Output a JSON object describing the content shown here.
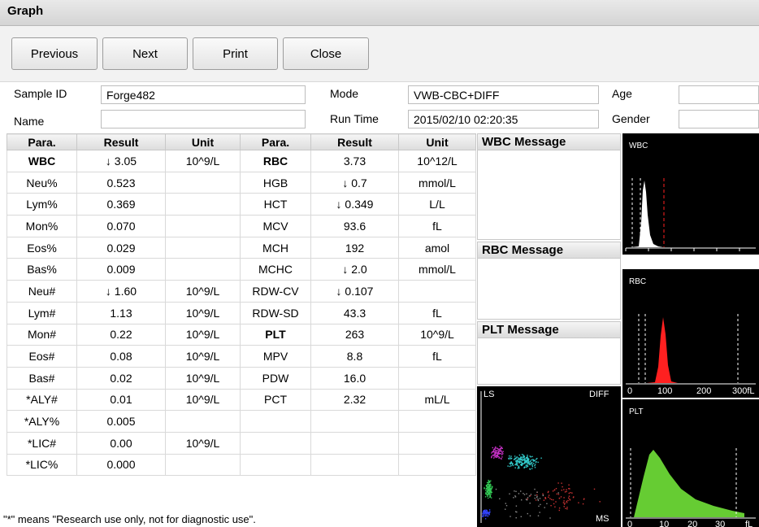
{
  "window": {
    "title": "Graph"
  },
  "toolbar": {
    "previous": "Previous",
    "next": "Next",
    "print": "Print",
    "close": "Close"
  },
  "info": {
    "sample_id_label": "Sample ID",
    "sample_id": "Forge482",
    "mode_label": "Mode",
    "mode": "VWB-CBC+DIFF",
    "age_label": "Age",
    "age": "",
    "name_label": "Name",
    "name": "",
    "run_time_label": "Run Time",
    "run_time": "2015/02/10 02:20:35",
    "gender_label": "Gender",
    "gender": ""
  },
  "table": {
    "headers": [
      "Para.",
      "Result",
      "Unit",
      "Para.",
      "Result",
      "Unit"
    ],
    "rows": [
      {
        "p1": "WBC",
        "r1": "↓ 3.05",
        "u1": "10^9/L",
        "p2": "RBC",
        "r2": "3.73",
        "u2": "10^12/L"
      },
      {
        "p1": "Neu%",
        "r1": "0.523",
        "u1": "",
        "p2": "HGB",
        "r2": "↓ 0.7",
        "u2": "mmol/L"
      },
      {
        "p1": "Lym%",
        "r1": "0.369",
        "u1": "",
        "p2": "HCT",
        "r2": "↓ 0.349",
        "u2": "L/L"
      },
      {
        "p1": "Mon%",
        "r1": "0.070",
        "u1": "",
        "p2": "MCV",
        "r2": "93.6",
        "u2": "fL"
      },
      {
        "p1": "Eos%",
        "r1": "0.029",
        "u1": "",
        "p2": "MCH",
        "r2": "192",
        "u2": "amol"
      },
      {
        "p1": "Bas%",
        "r1": "0.009",
        "u1": "",
        "p2": "MCHC",
        "r2": "↓ 2.0",
        "u2": "mmol/L"
      },
      {
        "p1": "Neu#",
        "r1": "↓ 1.60",
        "u1": "10^9/L",
        "p2": "RDW-CV",
        "r2": "↓ 0.107",
        "u2": ""
      },
      {
        "p1": "Lym#",
        "r1": "1.13",
        "u1": "10^9/L",
        "p2": "RDW-SD",
        "r2": "43.3",
        "u2": "fL"
      },
      {
        "p1": "Mon#",
        "r1": "0.22",
        "u1": "10^9/L",
        "p2": "PLT",
        "r2": "263",
        "u2": "10^9/L"
      },
      {
        "p1": "Eos#",
        "r1": "0.08",
        "u1": "10^9/L",
        "p2": "MPV",
        "r2": "8.8",
        "u2": "fL"
      },
      {
        "p1": "Bas#",
        "r1": "0.02",
        "u1": "10^9/L",
        "p2": "PDW",
        "r2": "16.0",
        "u2": ""
      },
      {
        "p1": "*ALY#",
        "r1": "0.01",
        "u1": "10^9/L",
        "p2": "PCT",
        "r2": "2.32",
        "u2": "mL/L"
      },
      {
        "p1": "*ALY%",
        "r1": "0.005",
        "u1": "",
        "p2": "",
        "r2": "",
        "u2": ""
      },
      {
        "p1": "*LIC#",
        "r1": "0.00",
        "u1": "10^9/L",
        "p2": "",
        "r2": "",
        "u2": ""
      },
      {
        "p1": "*LIC%",
        "r1": "0.000",
        "u1": "",
        "p2": "",
        "r2": "",
        "u2": ""
      }
    ]
  },
  "messages": {
    "wbc": "WBC Message",
    "rbc": "RBC Message",
    "plt": "PLT Message"
  },
  "graphs": {
    "wbc": {
      "title": "WBC",
      "color": "#ffffff"
    },
    "rbc": {
      "title": "RBC",
      "color": "#ff2020",
      "ticks": [
        "0",
        "100",
        "200",
        "300fL"
      ]
    },
    "plt": {
      "title": "PLT",
      "color": "#66cc33",
      "ticks": [
        "0",
        "10",
        "20",
        "30",
        "fL"
      ]
    },
    "scatter": {
      "y_label": "LS",
      "x_label": "MS",
      "title": "DIFF"
    }
  },
  "footer_note": "\"*\" means \"Research use only, not for diagnostic use\"."
}
